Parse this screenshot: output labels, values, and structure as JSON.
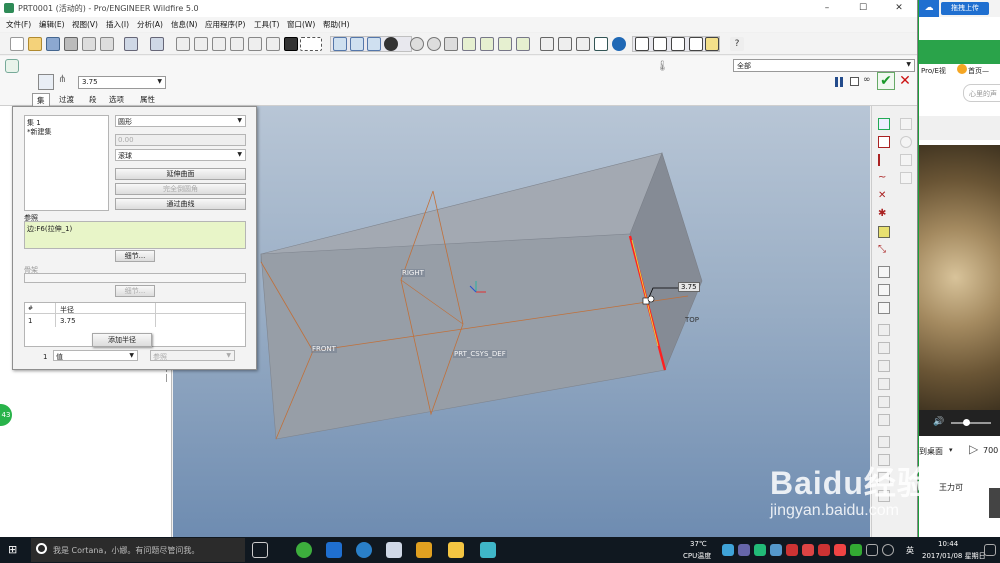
{
  "window": {
    "title": "PRT0001 (活动的) - Pro/ENGINEER Wildfire 5.0",
    "minimize": "–",
    "maximize": "☐",
    "close": "✕"
  },
  "menu": [
    "文件(F)",
    "编辑(E)",
    "视图(V)",
    "插入(I)",
    "分析(A)",
    "信息(N)",
    "应用程序(P)",
    "工具(T)",
    "窗口(W)",
    "帮助(H)"
  ],
  "dashboard": {
    "radius_value": "3.75",
    "tabs": [
      "集",
      "过渡",
      "段",
      "选项",
      "属性"
    ],
    "filter_value": "全部"
  },
  "panel": {
    "sets": [
      "集 1",
      "*新建集"
    ],
    "shape_value": "圆形",
    "disabled_value": "0.00",
    "method_value": "滚球",
    "btn_extend": "延伸曲面",
    "btn_full_round": "完全倒圆角",
    "btn_through_curve": "通过曲线",
    "ref_label": "参照",
    "ref_value": "边:F6(拉伸_1)",
    "details_btn": "细节...",
    "spine_label": "骨架",
    "details_btn2": "细节...",
    "table_headers": [
      "#",
      "半径"
    ],
    "table_row": [
      "1",
      "3.75"
    ],
    "add_radius_btn": "添加半径",
    "bottom_index": "1",
    "bottom_value": "值",
    "bottom_ref": "参照"
  },
  "model": {
    "labels": {
      "right": "RIGHT",
      "front": "FRONT",
      "top": "TOP",
      "csys": "PRT_CSYS_DEF",
      "dim": "3.75"
    }
  },
  "side": {
    "upload_btn": "拖拽上传",
    "tab_proe": "Pro/E视",
    "tab_home": "首页—",
    "input_placeholder": "心里的声",
    "desktop": "到桌面",
    "count": "700",
    "username": "王力可"
  },
  "taskbar": {
    "search_placeholder": "我是 Cortana，小娜。有问题尽管问我。",
    "temp": "37℃",
    "temp_label": "CPU温度",
    "ime": "英",
    "time": "10:44",
    "date": "2017/01/08 星期日"
  },
  "watermark": {
    "line1": "Baidu经验",
    "line2": "jingyan.baidu.com"
  },
  "badge": "43",
  "colors": {
    "accent_green": "#2e8b57",
    "highlight": "#e8f5c8",
    "edge_red": "#ff2020"
  }
}
